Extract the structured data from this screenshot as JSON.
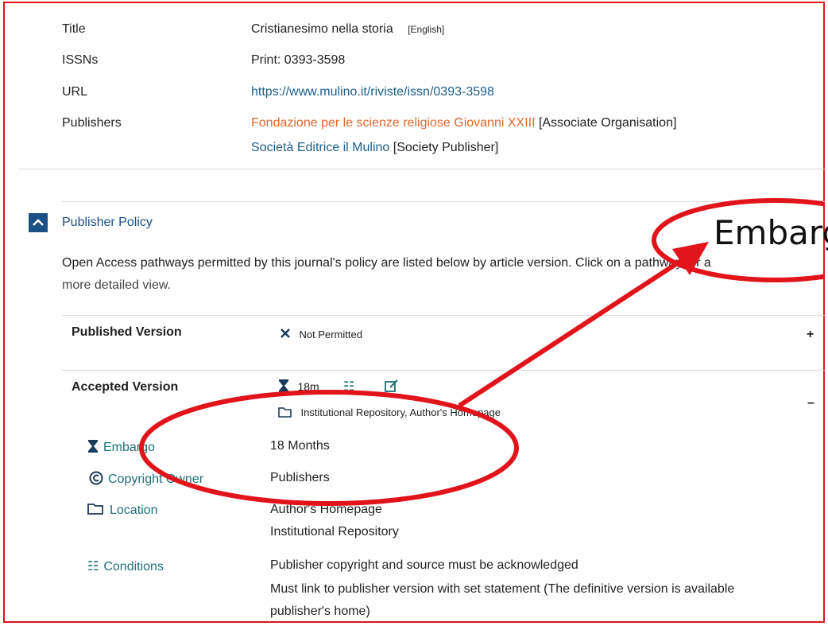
{
  "info": {
    "title_label": "Title",
    "title_value": "Cristianesimo nella storia",
    "title_lang": "[English]",
    "issns_label": "ISSNs",
    "issns_value": "Print: 0393-3598",
    "url_label": "URL",
    "url_value": "https://www.mulino.it/riviste/issn/0393-3598",
    "publishers_label": "Publishers",
    "publisher1_name": "Fondazione per le scienze religiose Giovanni XXIII",
    "publisher1_role": "[Associate Organisation]",
    "publisher2_name": "Società Editrice il Mulino",
    "publisher2_role": "[Society Publisher]"
  },
  "policy": {
    "header": "Publisher Policy",
    "description_line1": "Open Access pathways permitted by this journal's policy are listed below by article version. Click on a pathway for a",
    "description_line2": "more detailed view.",
    "published": {
      "label": "Published Version",
      "status": "Not Permitted",
      "toggle": "+"
    },
    "accepted": {
      "label": "Accepted Version",
      "embargo_short": "18m",
      "locations_short": "Institutional Repository, Author's Homepage",
      "toggle": "–"
    },
    "details": {
      "embargo_label": "Embargo",
      "embargo_value": "18 Months",
      "copyright_label": "Copyright Owner",
      "copyright_value": "Publishers",
      "location_label": "Location",
      "location_value1": "Author's Homepage",
      "location_value2": "Institutional Repository",
      "conditions_label": "Conditions",
      "condition1": "Publisher copyright and source must be acknowledged",
      "condition2": "Must link to publisher version with set statement (The definitive version is available",
      "condition3": "publisher's home)"
    }
  },
  "annotation": {
    "callout_text": "Embarg",
    "color": "#e0141a"
  }
}
